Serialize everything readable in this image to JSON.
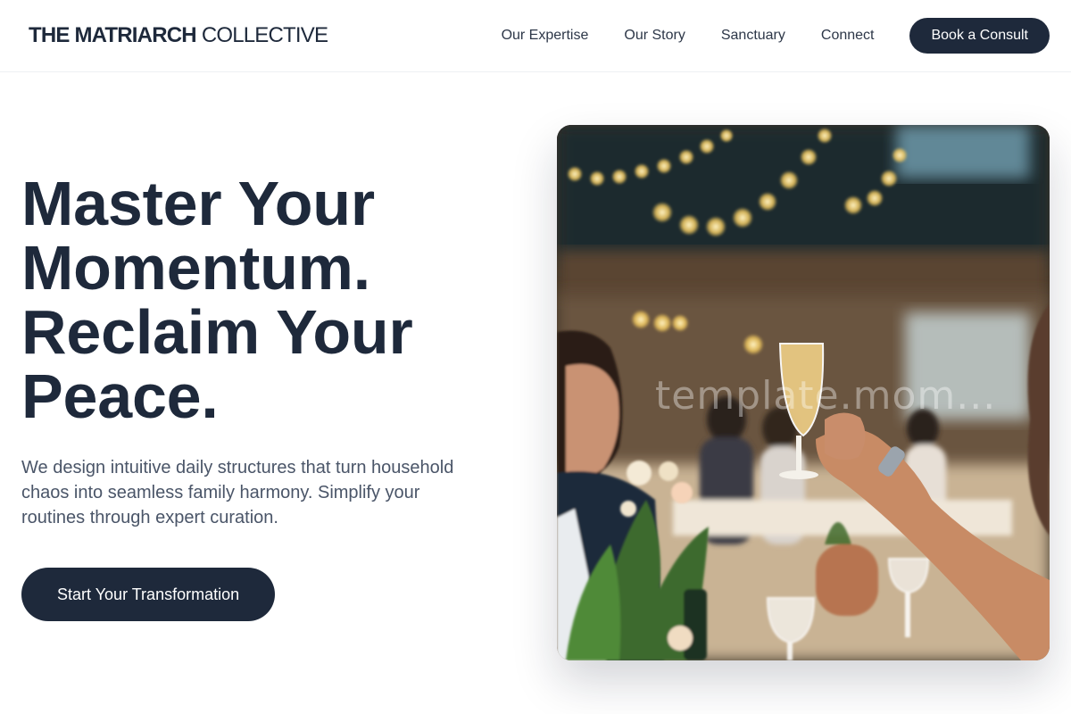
{
  "brand": {
    "name_bold": "THE MATRIARCH",
    "name_light": "COLLECTIVE"
  },
  "nav": {
    "links": [
      "Our Expertise",
      "Our Story",
      "Sanctuary",
      "Connect"
    ],
    "cta_label": "Book a Consult"
  },
  "hero": {
    "title_lines": [
      "Master Your",
      "Momentum.",
      "Reclaim Your",
      "Peace."
    ],
    "description": "We design intuitive daily structures that turn household chaos into seamless family harmony. Simplify your routines through expert curation.",
    "cta_label": "Start Your Transformation"
  },
  "image": {
    "watermark": "template.mom...",
    "subject": "celebration-toast-photo"
  },
  "colors": {
    "primary": "#1e293b",
    "text_muted": "#4a5568",
    "background": "#ffffff"
  }
}
